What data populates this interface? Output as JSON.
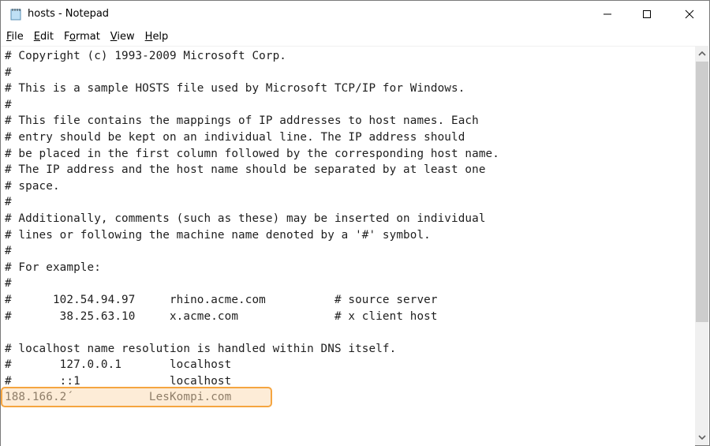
{
  "window": {
    "title": "hosts - Notepad",
    "controls": [
      "minimize",
      "maximize",
      "close"
    ]
  },
  "menu": [
    {
      "accel": "F",
      "rest": "ile"
    },
    {
      "accel": "E",
      "rest": "dit"
    },
    {
      "pre": "F",
      "accel": "o",
      "rest": "rmat"
    },
    {
      "accel": "V",
      "rest": "iew"
    },
    {
      "accel": "H",
      "rest": "elp"
    }
  ],
  "editor": {
    "lines": [
      "# Copyright (c) 1993-2009 Microsoft Corp.",
      "#",
      "# This is a sample HOSTS file used by Microsoft TCP/IP for Windows.",
      "#",
      "# This file contains the mappings of IP addresses to host names. Each",
      "# entry should be kept on an individual line. The IP address should",
      "# be placed in the first column followed by the corresponding host name.",
      "# The IP address and the host name should be separated by at least one",
      "# space.",
      "#",
      "# Additionally, comments (such as these) may be inserted on individual",
      "# lines or following the machine name denoted by a '#' symbol.",
      "#",
      "# For example:",
      "#",
      "#      102.54.94.97     rhino.acme.com          # source server",
      "#       38.25.63.10     x.acme.com              # x client host",
      "",
      "# localhost name resolution is handled within DNS itself.",
      "#       127.0.0.1       localhost",
      "#       ::1             localhost"
    ],
    "highlighted_line": "188.166.2´           LesKompi.com",
    "highlight_color": "#f5a540"
  },
  "scrollbar": {
    "position_fraction": 0.0
  }
}
